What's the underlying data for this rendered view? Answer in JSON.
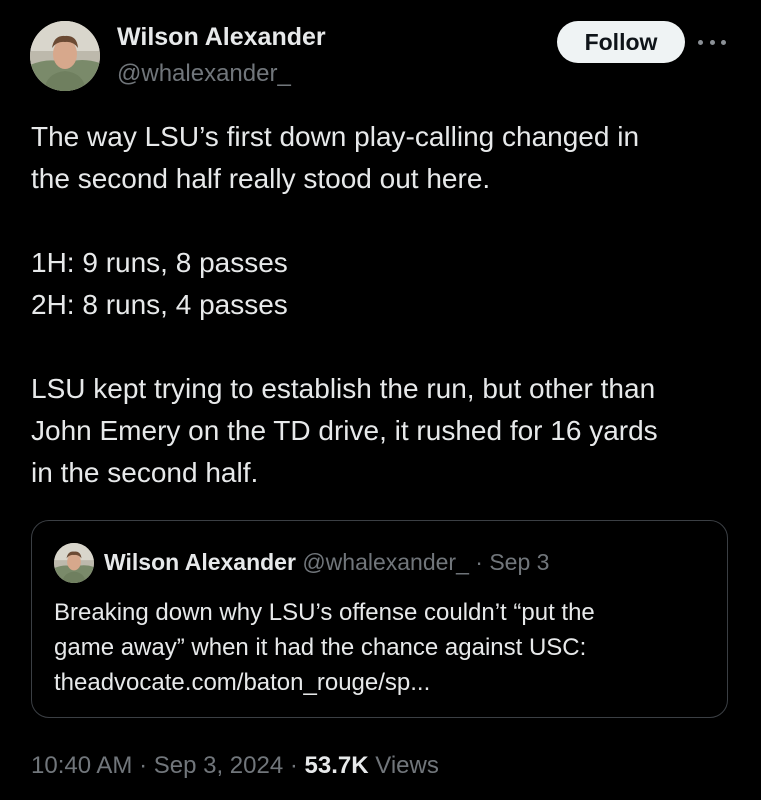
{
  "author": {
    "name": "Wilson Alexander",
    "handle": "@whalexander_"
  },
  "follow_label": "Follow",
  "tweet": {
    "lines": [
      "The way LSU’s first down play-calling changed in",
      "the second half really stood out here.",
      "1H: 9 runs, 8 passes",
      "2H: 8 runs, 4 passes",
      "LSU kept trying to establish the run, but other than",
      "John Emery on the TD drive, it rushed for 16 yards",
      "in the second half."
    ]
  },
  "quote": {
    "name": "Wilson Alexander",
    "handle": "@whalexander_",
    "separator": "·",
    "date": "Sep 3",
    "lines": [
      "Breaking down why LSU’s offense couldn’t “put the",
      "game away” when it had the chance against USC:",
      "theadvocate.com/baton_rouge/sp..."
    ]
  },
  "footer": {
    "time": "10:40 AM",
    "separator": "·",
    "date": "Sep 3, 2024",
    "views_count": "53.7K",
    "views_label": "Views"
  },
  "icons": {
    "more": "more-horizontal-icon"
  },
  "colors": {
    "background": "#000000",
    "text": "#e7e9ea",
    "muted": "#71767b",
    "follow_bg": "#eff3f4",
    "border": "#3b3f44"
  }
}
